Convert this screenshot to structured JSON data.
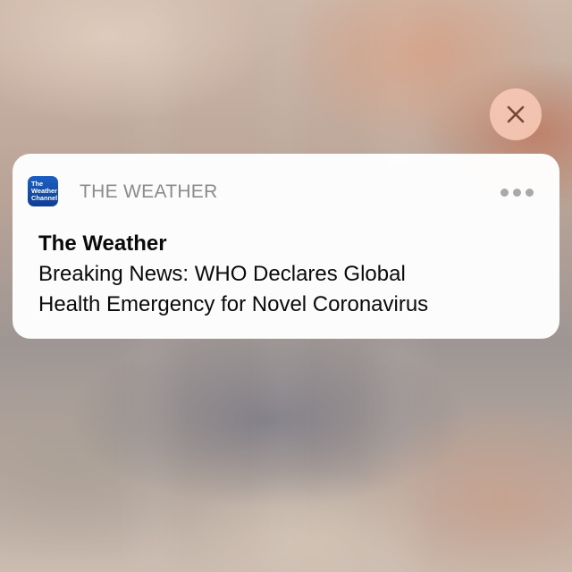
{
  "notification": {
    "app_icon_lines": [
      "The",
      "Weather",
      "Channel"
    ],
    "app_name": "THE WEATHER",
    "title": "The Weather",
    "body_lines": [
      "Breaking News: WHO Declares Global",
      "Health Emergency for Novel Coronavirus"
    ]
  },
  "icons": {
    "close": "close-icon",
    "more": "more-options-icon",
    "app": "weather-channel-app-icon"
  },
  "colors": {
    "app_icon": "#1c5fc1",
    "close_button": "#f6c8b4",
    "card_background": "#ffffff",
    "app_name_text": "#8a8a8f"
  }
}
